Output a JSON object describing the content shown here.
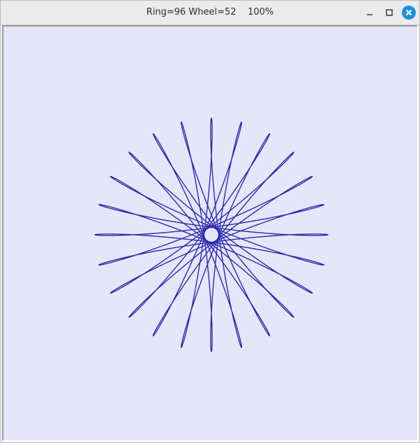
{
  "window": {
    "title": "Ring=96 Wheel=52    100%",
    "controls": {
      "minimize_icon": "minimize-icon",
      "maximize_icon": "maximize-icon",
      "close_icon": "close-icon"
    }
  },
  "canvas": {
    "background_color": "#e6e6fa",
    "spirograph": {
      "ring": 96,
      "wheel": 52,
      "zoom_percent": 100,
      "stroke_color": "#2b2bab"
    }
  }
}
